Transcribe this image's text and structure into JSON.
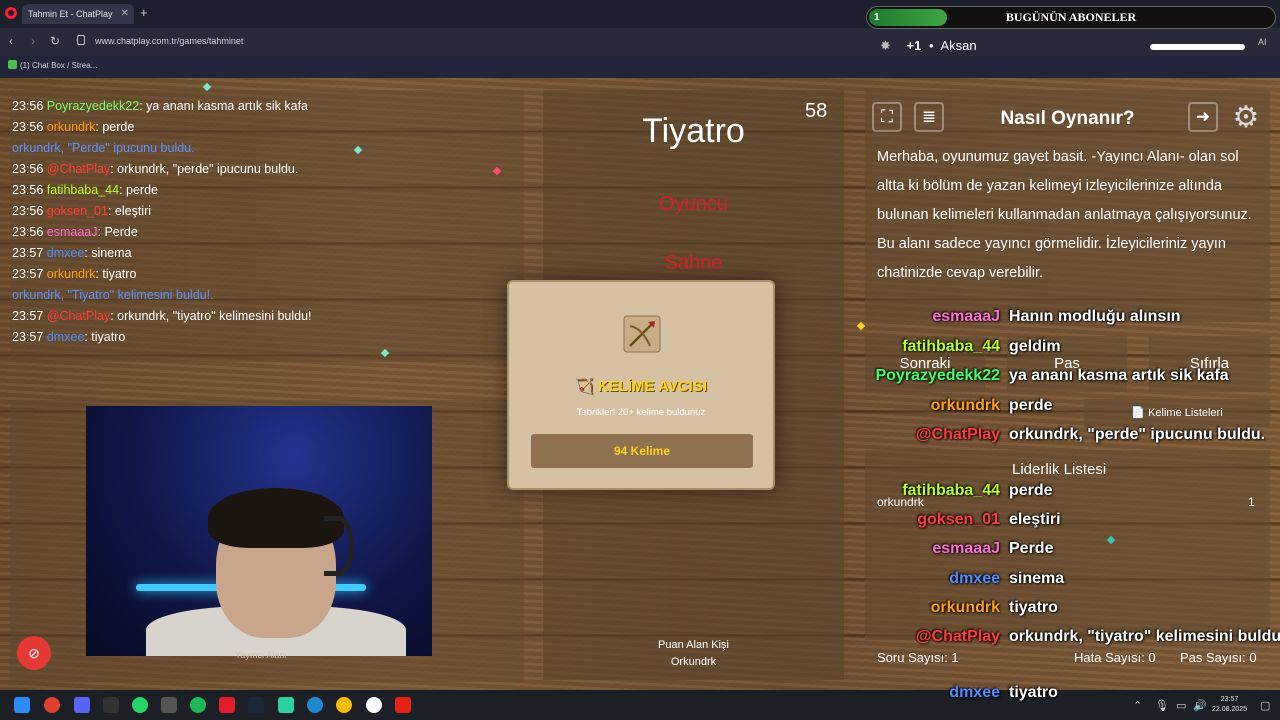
{
  "browser": {
    "tab_title": "Tahmin Et - ChatPlay",
    "url": "www.chatplay.com.tr/games/tahminet",
    "bookmark": "(1) Chat Box / Strea..."
  },
  "overlay": {
    "sub_count": "1",
    "sub_title": "BUGÜNÜN ABONELER",
    "accent_plus": "+1",
    "accent_label": "Aksan",
    "ai_label": "AI"
  },
  "chat": [
    {
      "time": "23:56",
      "user": "Poyrazyedekk22",
      "color": "#7cff6b",
      "text": ": ya ananı kasma artık sik kafa"
    },
    {
      "time": "23:56",
      "user": "orkundrk",
      "color": "#ff9f1a",
      "text": ": perde"
    },
    {
      "time": "",
      "user": "",
      "color": "#5e92ff",
      "system": "orkundrk, \"Perde\" ipucunu buldu."
    },
    {
      "time": "23:56",
      "user": "@ChatPlay",
      "color": "#ff3b3b",
      "text": ": orkundrk, \"perde\" ipucunu buldu."
    },
    {
      "time": "23:56",
      "user": "fatihbaba_44",
      "color": "#b6ff2a",
      "text": ": perde"
    },
    {
      "time": "23:56",
      "user": "goksen_01",
      "color": "#ff3b3b",
      "text": ": eleştiri"
    },
    {
      "time": "23:56",
      "user": "esmaaaJ",
      "color": "#ff6fd1",
      "text": ": Perde"
    },
    {
      "time": "23:57",
      "user": "dmxee",
      "color": "#4f8dff",
      "text": ": sinema"
    },
    {
      "time": "23:57",
      "user": "orkundrk",
      "color": "#ff9f1a",
      "text": ": tiyatro"
    },
    {
      "time": "",
      "user": "",
      "color": "#5e92ff",
      "system": "orkundrk, \"Tiyatro\" kelimesini buldu!."
    },
    {
      "time": "23:57",
      "user": "@ChatPlay",
      "color": "#ff3b3b",
      "text": ": orkundrk, \"tiyatro\" kelimesini buldu!"
    },
    {
      "time": "23:57",
      "user": "dmxee",
      "color": "#4f8dff",
      "text": ": tiyatro"
    }
  ],
  "cam_label": "Yayıncı Alanı",
  "game": {
    "timer": "58",
    "word": "Tiyatro",
    "forbidden": [
      "Oyuncu",
      "Sahne"
    ],
    "scorer_label": "Puan Alan Kişi",
    "scorer_name": "Orkundrk"
  },
  "popup": {
    "title": "KELİME AVCISI",
    "subtitle": "Tebrikler! 20+ kelime buldunuz",
    "count": "94 Kelime"
  },
  "how": {
    "title": "Nasıl Oynanır?",
    "text": "Merhaba, oyunumuz gayet basit. -Yayıncı Alanı- olan sol altta ki bölüm de yazan kelimeyi izleyicilerinize altında bulunan kelimeleri kullanmadan anlatmaya çalışıyorsunuz. Bu alanı sadece yayıncı görmelidir. İzleyicileriniz yayın chatinizde cevap verebilir."
  },
  "controls": {
    "next": "Sonraki",
    "pass": "Pas",
    "reset": "Sıfırla",
    "word_lists": "Kelime Listeleri"
  },
  "leaderboard": {
    "title": "Liderlik Listesi",
    "entries": [
      {
        "name": "orkundrk",
        "score": "1"
      }
    ]
  },
  "stats": {
    "questions": "Soru Sayısı: 1",
    "errors": "Hata Sayısı: 0",
    "passes": "Pas Sayısı: 0"
  },
  "overlay_chat": [
    {
      "user": "esmaaaJ",
      "color": "#ff6fd1",
      "text": "Hanın modluğu alınsın"
    },
    {
      "user": "fatihbaba_44",
      "color": "#b6ff2a",
      "text": "geldim"
    },
    {
      "user": "Poyrazyedekk22",
      "color": "#3fff6b",
      "text": "ya ananı kasma artık sik kafa"
    },
    {
      "user": "orkundrk",
      "color": "#ff9f1a",
      "text": "perde"
    },
    {
      "user": "@ChatPlay",
      "color": "#ff3b3b",
      "text": "orkundrk, \"perde\" ipucunu buldu."
    },
    {
      "user": "fatihbaba_44",
      "color": "#b6ff2a",
      "text": "perde"
    },
    {
      "user": "goksen_01",
      "color": "#ff3b3b",
      "text": "eleştiri"
    },
    {
      "user": "esmaaaJ",
      "color": "#ff6fd1",
      "text": "Perde"
    },
    {
      "user": "dmxee",
      "color": "#4f8dff",
      "text": "sinema"
    },
    {
      "user": "orkundrk",
      "color": "#ff9f1a",
      "text": "tiyatro"
    },
    {
      "user": "@ChatPlay",
      "color": "#ff3b3b",
      "text": "orkundrk, \"tiyatro\" kelimesini buldu!"
    },
    {
      "user": "dmxee",
      "color": "#4f8dff",
      "text": "tiyatro"
    }
  ],
  "taskbar": {
    "time": "23:57",
    "date": "22.08.2025"
  }
}
